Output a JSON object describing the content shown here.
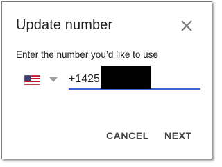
{
  "dialog": {
    "title": "Update number",
    "prompt": "Enter the number you’d like to use",
    "country": {
      "flag_icon": "us-flag-icon",
      "dropdown_icon": "caret-down-icon"
    },
    "phone": {
      "value": "+1425"
    },
    "actions": {
      "cancel_label": "CANCEL",
      "next_label": "NEXT"
    },
    "close_icon": "close-icon"
  },
  "colors": {
    "accent": "#3367d6",
    "text": "#212121",
    "button_text": "#424242",
    "icon": "#757575"
  }
}
